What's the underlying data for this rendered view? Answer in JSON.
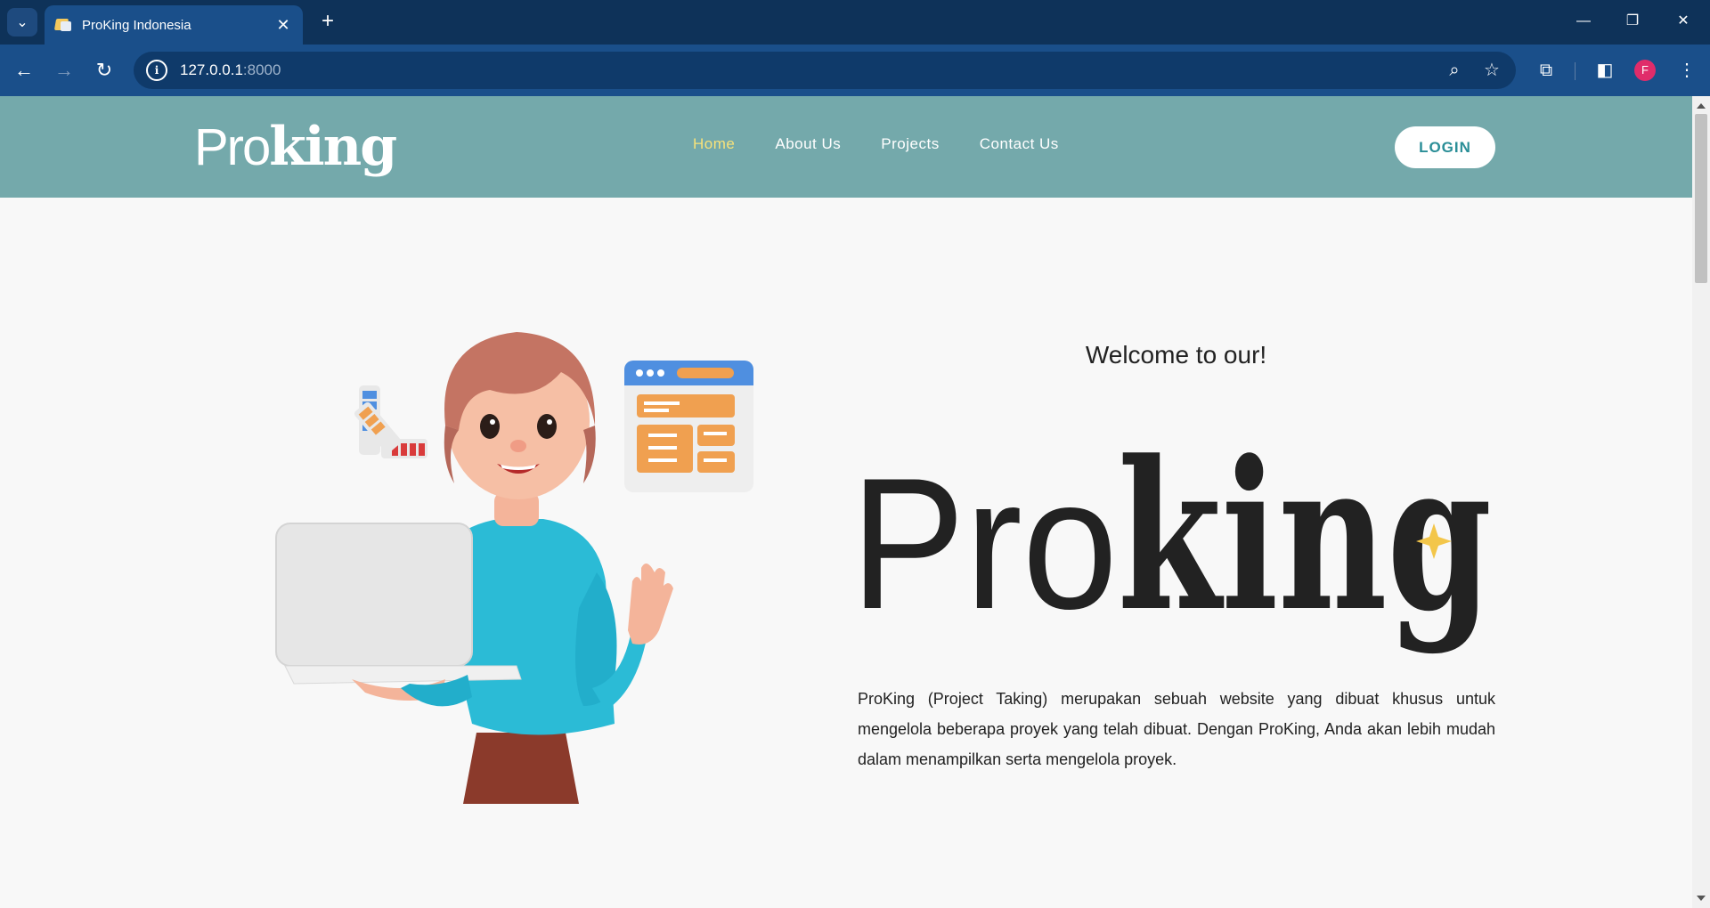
{
  "browser": {
    "tab_title": "ProKing Indonesia",
    "url_host": "127.0.0.1",
    "url_port": ":8000",
    "profile_initial": "F"
  },
  "site": {
    "logo_light": "Pro",
    "logo_heavy": "king",
    "nav": {
      "home": "Home",
      "about": "About Us",
      "projects": "Projects",
      "contact": "Contact Us"
    },
    "login_label": "LOGIN"
  },
  "hero": {
    "welcome": "Welcome to our!",
    "brand_light": "Pro",
    "brand_heavy": "king",
    "description": "ProKing (Project Taking) merupakan sebuah website yang dibuat khusus untuk mengelola beberapa proyek yang telah dibuat. Dengan ProKing, Anda akan lebih mudah dalam menampilkan serta mengelola proyek."
  },
  "colors": {
    "header_bg": "#74a9ab",
    "nav_active": "#f7e27a",
    "login_text": "#2a8e97",
    "browser_frame": "#0e3259",
    "toolbar": "#1a4f8a"
  }
}
